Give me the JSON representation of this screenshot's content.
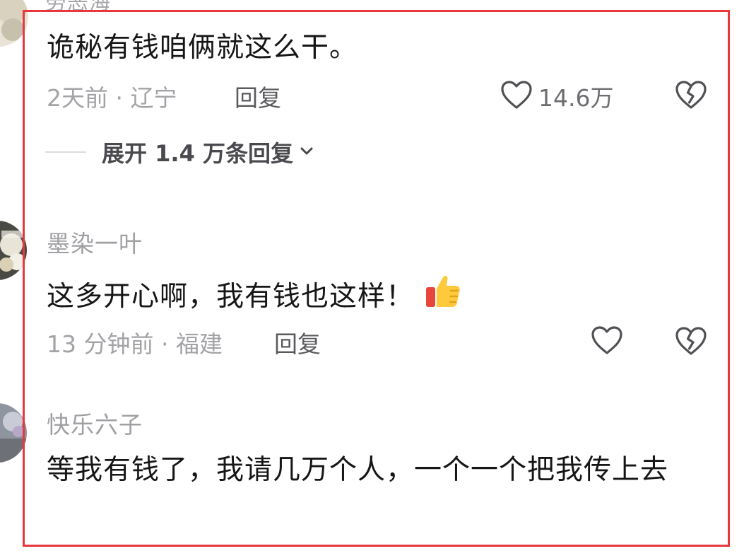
{
  "top_comment": {
    "cut_username": "勞恶海",
    "text": "诡秘有钱咱俩就这么干。",
    "meta": "2天前 · 辽宁",
    "reply_label": "回复",
    "like_count": "14.6万",
    "expand_label": "展开 1.4 万条回复"
  },
  "comments": [
    {
      "username": "墨染一叶",
      "text": "这多开心啊，我有钱也这样！",
      "emoji": "thumbs-up-icon",
      "meta": "13 分钟前 · 福建",
      "reply_label": "回复"
    },
    {
      "username": "快乐六子",
      "text": "等我有钱了，我请几万个人，一个一个把我传上去"
    }
  ],
  "colors": {
    "highlight_border": "#e8383d",
    "text_primary": "#161616",
    "text_secondary": "#a3a3a7",
    "reply": "#5a5a5e"
  }
}
